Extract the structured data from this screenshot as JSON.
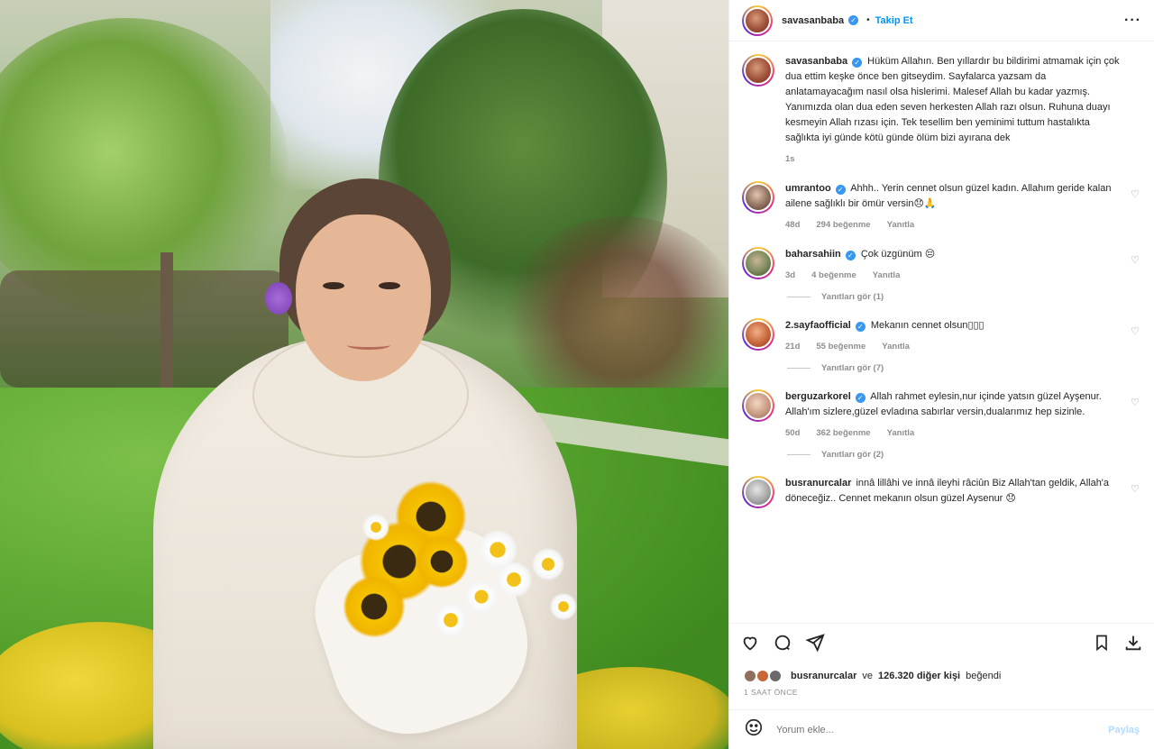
{
  "header": {
    "username": "savasanbaba",
    "follow_label": "Takip Et",
    "more_label": "···"
  },
  "caption": {
    "username": "savasanbaba",
    "text": "Hüküm Allahın. Ben yıllardır bu bildirimi atmamak için çok dua ettim keşke önce ben gitseydim. Sayfalarca yazsam da anlatamayacağım nasıl olsa hislerimi. Malesef Allah bu kadar yazmış. Yanımızda olan dua eden seven herkesten Allah razı olsun. Ruhuna duayı kesmeyin Allah rızası için. Tek tesellim ben yeminimi tuttum hastalıkta sağlıkta iyi günde kötü günde ölüm bizi ayırana dek",
    "time": "1s"
  },
  "comments": [
    {
      "username": "umrantoo",
      "text": "Ahhh.. Yerin cennet olsun güzel kadın. Allahım geride kalan ailene sağlıklı bir ömür versin😞🙏",
      "time": "48d",
      "likes": "294 beğenme",
      "reply": "Yanıtla",
      "replies": ""
    },
    {
      "username": "baharsahiin",
      "text": "Çok üzgünüm 😔",
      "time": "3d",
      "likes": "4 beğenme",
      "reply": "Yanıtla",
      "replies": "Yanıtları gör (1)"
    },
    {
      "username": "2.sayfaofficial",
      "text": "Mekanın cennet olsun▯▯▯",
      "time": "21d",
      "likes": "55 beğenme",
      "reply": "Yanıtla",
      "replies": "Yanıtları gör (7)"
    },
    {
      "username": "berguzarkorel",
      "text": "Allah rahmet eylesin,nur içinde yatsın güzel Ayşenur. Allah'ım sizlere,güzel evladına sabırlar versin,dualarımız hep sizinle.",
      "time": "50d",
      "likes": "362 beğenme",
      "reply": "Yanıtla",
      "replies": "Yanıtları gör (2)"
    },
    {
      "username": "busranurcalar",
      "text": "innâ lillâhi ve innâ ileyhi râciûn Biz Allah'tan geldik, Allah'a döneceğiz.. Cennet mekanın olsun güzel Aysenur 😞",
      "time": "",
      "likes": "",
      "reply": "",
      "replies": ""
    }
  ],
  "likes": {
    "user": "busranurcalar",
    "connector": "ve",
    "count": "126.320 diğer kişi",
    "suffix": "beğendi"
  },
  "post_time": "1 SAAT ÖNCE",
  "add_comment": {
    "placeholder": "Yorum ekle...",
    "post_label": "Paylaş"
  }
}
